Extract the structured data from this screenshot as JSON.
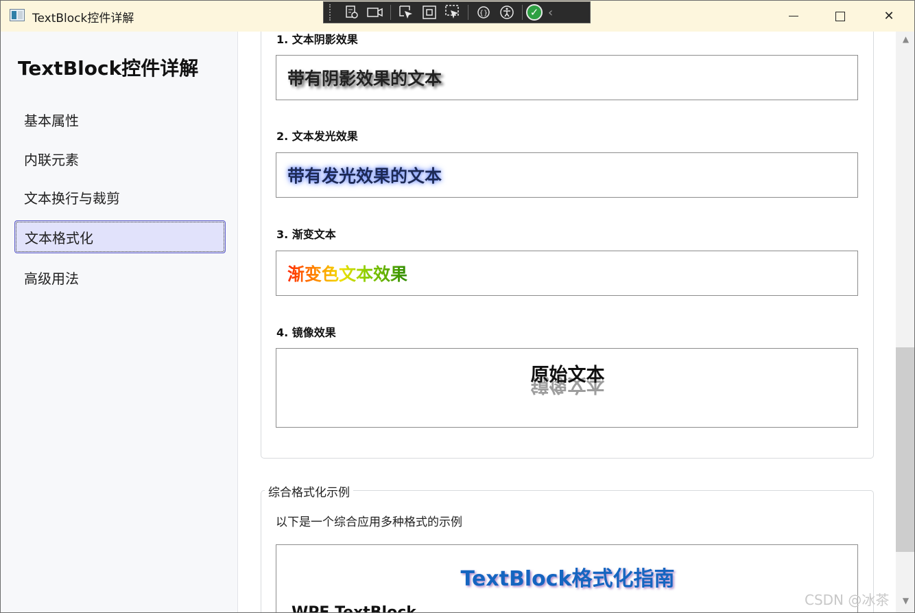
{
  "window": {
    "title": "TextBlock控件详解",
    "minimize_glyph": "",
    "close_glyph": "✕"
  },
  "debug_toolbar": {
    "icons": [
      "live-visual-tree-icon",
      "video-icon",
      "select-element-icon",
      "display-layout-adorners-icon",
      "track-focus-icon",
      "hot-reload-icon",
      "accessibility-icon",
      "check-icon",
      "collapse-icon"
    ]
  },
  "sidebar": {
    "title": "TextBlock控件详解",
    "items": [
      {
        "label": "基本属性",
        "active": false
      },
      {
        "label": "内联元素",
        "active": false
      },
      {
        "label": "文本换行与裁剪",
        "active": false
      },
      {
        "label": "文本格式化",
        "active": true
      },
      {
        "label": "高级用法",
        "active": false
      }
    ]
  },
  "content": {
    "sections": [
      {
        "label": "1. 文本阴影效果",
        "sample": "带有阴影效果的文本"
      },
      {
        "label": "2. 文本发光效果",
        "sample": "带有发光效果的文本"
      },
      {
        "label": "3. 渐变文本",
        "sample": "渐变色文本效果"
      },
      {
        "label": "4. 镜像效果",
        "sample": "原始文本",
        "reflection": "镜像文本"
      }
    ],
    "group": {
      "header": "综合格式化示例",
      "description": "以下是一个综合应用多种格式的示例",
      "guide_title": "TextBlock格式化指南",
      "partial_line": "WPF TextBlock"
    }
  },
  "colors": {
    "accent_nav": "#e1e2fb",
    "guide_title": "#1565c0",
    "titlebar": "#fdf6dd"
  },
  "watermark": "CSDN @冰茶"
}
